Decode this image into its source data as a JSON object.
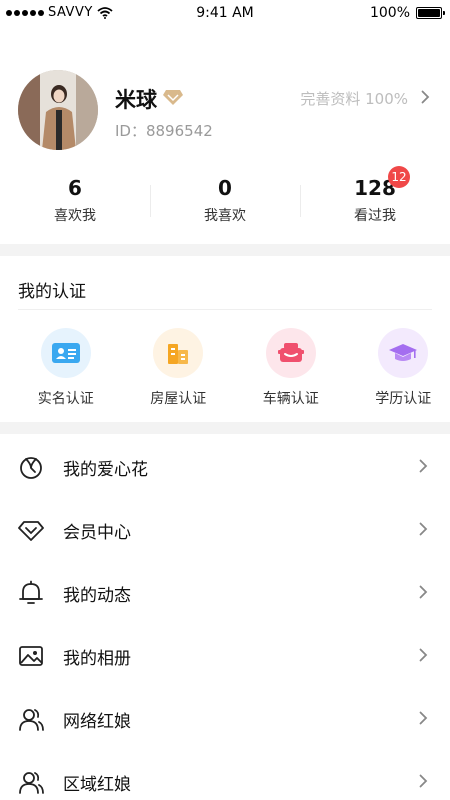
{
  "status_bar": {
    "carrier": "SAVVY",
    "time": "9:41 AM",
    "battery": "100%"
  },
  "profile": {
    "name": "米球",
    "id_text": "ID：8896542",
    "complete_text": "完善资料 100%"
  },
  "stats": [
    {
      "value": "6",
      "label": "喜欢我"
    },
    {
      "value": "0",
      "label": "我喜欢"
    },
    {
      "value": "128",
      "label": "看过我"
    }
  ],
  "badge": "12",
  "certification": {
    "title": "我的认证",
    "items": [
      {
        "label": "实名认证",
        "icon": "id-card-icon",
        "color": "#3aa8f0"
      },
      {
        "label": "房屋认证",
        "icon": "building-icon",
        "color": "#f5a623"
      },
      {
        "label": "车辆认证",
        "icon": "car-icon",
        "color": "#f0506e"
      },
      {
        "label": "学历认证",
        "icon": "graduation-cap-icon",
        "color": "#a46ef0"
      }
    ]
  },
  "menu": [
    {
      "label": "我的爱心花",
      "icon": "flower-icon"
    },
    {
      "label": "会员中心",
      "icon": "diamond-icon"
    },
    {
      "label": "我的动态",
      "icon": "bell-icon"
    },
    {
      "label": "我的相册",
      "icon": "photo-icon"
    },
    {
      "label": "网络红娘",
      "icon": "matchmaker-icon"
    },
    {
      "label": "区域红娘",
      "icon": "matchmaker-icon"
    }
  ]
}
